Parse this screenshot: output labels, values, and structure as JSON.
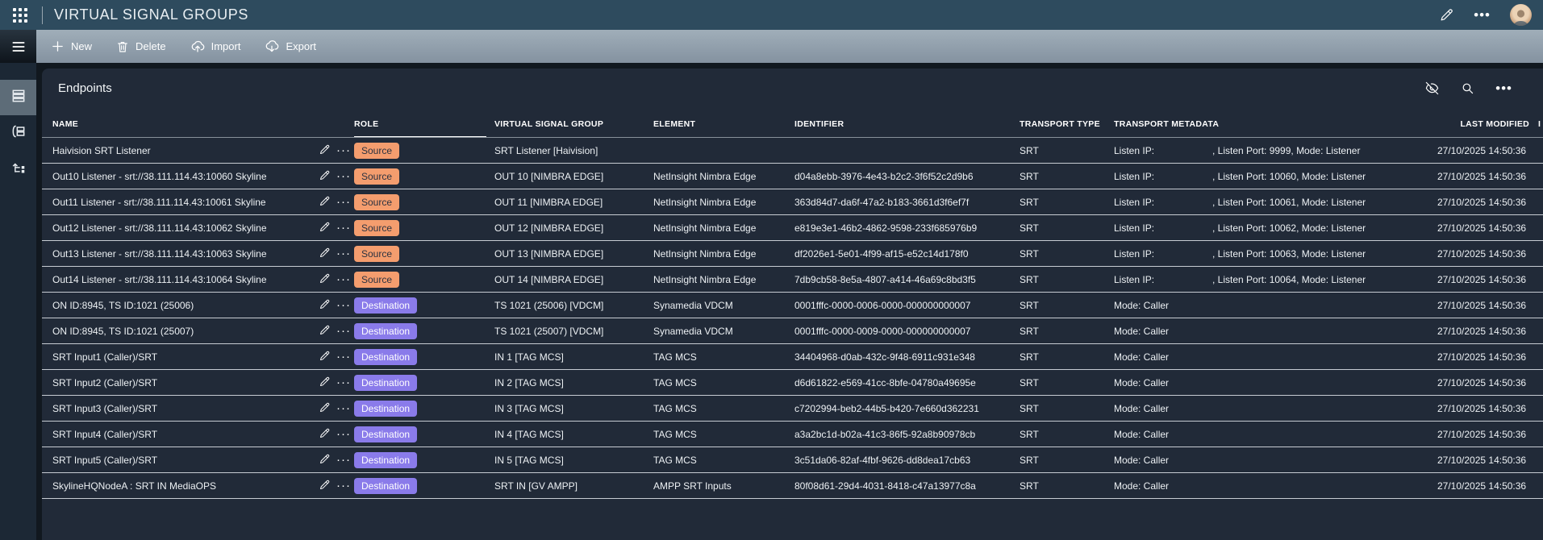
{
  "app": {
    "title": "VIRTUAL SIGNAL GROUPS"
  },
  "toolbar": {
    "items": [
      {
        "label": "New",
        "icon": "plus-icon"
      },
      {
        "label": "Delete",
        "icon": "trash-icon"
      },
      {
        "label": "Import",
        "icon": "cloud-import-icon"
      },
      {
        "label": "Export",
        "icon": "cloud-export-icon"
      }
    ]
  },
  "sidebar": {
    "items": [
      {
        "icon": "list-rows-icon",
        "selected": true
      },
      {
        "icon": "grouped-rows-icon",
        "selected": false
      },
      {
        "icon": "hierarchy-flow-icon",
        "selected": false
      }
    ]
  },
  "panel": {
    "title": "Endpoints",
    "actions": [
      "eye-off-icon",
      "search-icon",
      "ellipsis-icon"
    ]
  },
  "table": {
    "columns": [
      "NAME",
      "ROLE",
      "VIRTUAL SIGNAL GROUP",
      "ELEMENT",
      "IDENTIFIER",
      "TRANSPORT TYPE",
      "TRANSPORT METADATA",
      "LAST MODIFIED",
      "I"
    ],
    "sorted_column": "ROLE",
    "rows": [
      {
        "name": "Haivision SRT Listener",
        "role": "Source",
        "vsg": "SRT Listener [Haivision]",
        "element": "",
        "identifier": "",
        "transport_type": "SRT",
        "meta_label": "Listen IP:",
        "meta_rest": ", Listen Port: 9999, Mode: Listener",
        "last_modified": "27/10/2025 14:50:36"
      },
      {
        "name": "Out10 Listener - srt://38.111.114.43:10060 Skyline",
        "role": "Source",
        "vsg": "OUT 10 [NIMBRA EDGE]",
        "element": "NetInsight Nimbra Edge",
        "identifier": "d04a8ebb-3976-4e43-b2c2-3f6f52c2d9b6",
        "transport_type": "SRT",
        "meta_label": "Listen IP:",
        "meta_rest": ", Listen Port: 10060, Mode: Listener",
        "last_modified": "27/10/2025 14:50:36"
      },
      {
        "name": "Out11 Listener - srt://38.111.114.43:10061 Skyline",
        "role": "Source",
        "vsg": "OUT 11 [NIMBRA EDGE]",
        "element": "NetInsight Nimbra Edge",
        "identifier": "363d84d7-da6f-47a2-b183-3661d3f6ef7f",
        "transport_type": "SRT",
        "meta_label": "Listen IP:",
        "meta_rest": ", Listen Port: 10061, Mode: Listener",
        "last_modified": "27/10/2025 14:50:36"
      },
      {
        "name": "Out12 Listener - srt://38.111.114.43:10062 Skyline",
        "role": "Source",
        "vsg": "OUT 12 [NIMBRA EDGE]",
        "element": "NetInsight Nimbra Edge",
        "identifier": "e819e3e1-46b2-4862-9598-233f685976b9",
        "transport_type": "SRT",
        "meta_label": "Listen IP:",
        "meta_rest": ", Listen Port: 10062, Mode: Listener",
        "last_modified": "27/10/2025 14:50:36"
      },
      {
        "name": "Out13 Listener - srt://38.111.114.43:10063 Skyline",
        "role": "Source",
        "vsg": "OUT 13 [NIMBRA EDGE]",
        "element": "NetInsight Nimbra Edge",
        "identifier": "df2026e1-5e01-4f99-af15-e52c14d178f0",
        "transport_type": "SRT",
        "meta_label": "Listen IP:",
        "meta_rest": ", Listen Port: 10063, Mode: Listener",
        "last_modified": "27/10/2025 14:50:36"
      },
      {
        "name": "Out14 Listener - srt://38.111.114.43:10064 Skyline",
        "role": "Source",
        "vsg": "OUT 14 [NIMBRA EDGE]",
        "element": "NetInsight Nimbra Edge",
        "identifier": "7db9cb58-8e5a-4807-a414-46a69c8bd3f5",
        "transport_type": "SRT",
        "meta_label": "Listen IP:",
        "meta_rest": ", Listen Port: 10064, Mode: Listener",
        "last_modified": "27/10/2025 14:50:36"
      },
      {
        "name": "ON ID:8945, TS ID:1021 (25006)",
        "role": "Destination",
        "vsg": "TS 1021 (25006) [VDCM]",
        "element": "Synamedia VDCM",
        "identifier": "0001fffc-0000-0006-0000-000000000007",
        "transport_type": "SRT",
        "meta_label": "Mode: Caller",
        "meta_rest": "",
        "last_modified": "27/10/2025 14:50:36"
      },
      {
        "name": "ON ID:8945, TS ID:1021 (25007)",
        "role": "Destination",
        "vsg": "TS 1021 (25007) [VDCM]",
        "element": "Synamedia VDCM",
        "identifier": "0001fffc-0000-0009-0000-000000000007",
        "transport_type": "SRT",
        "meta_label": "Mode: Caller",
        "meta_rest": "",
        "last_modified": "27/10/2025 14:50:36"
      },
      {
        "name": "SRT Input1 (Caller)/SRT",
        "role": "Destination",
        "vsg": "IN 1 [TAG MCS]",
        "element": "TAG MCS",
        "identifier": "34404968-d0ab-432c-9f48-6911c931e348",
        "transport_type": "SRT",
        "meta_label": "Mode: Caller",
        "meta_rest": "",
        "last_modified": "27/10/2025 14:50:36"
      },
      {
        "name": "SRT Input2 (Caller)/SRT",
        "role": "Destination",
        "vsg": "IN 2 [TAG MCS]",
        "element": "TAG MCS",
        "identifier": "d6d61822-e569-41cc-8bfe-04780a49695e",
        "transport_type": "SRT",
        "meta_label": "Mode: Caller",
        "meta_rest": "",
        "last_modified": "27/10/2025 14:50:36"
      },
      {
        "name": "SRT Input3 (Caller)/SRT",
        "role": "Destination",
        "vsg": "IN 3 [TAG MCS]",
        "element": "TAG MCS",
        "identifier": "c7202994-beb2-44b5-b420-7e660d362231",
        "transport_type": "SRT",
        "meta_label": "Mode: Caller",
        "meta_rest": "",
        "last_modified": "27/10/2025 14:50:36"
      },
      {
        "name": "SRT Input4 (Caller)/SRT",
        "role": "Destination",
        "vsg": "IN 4 [TAG MCS]",
        "element": "TAG MCS",
        "identifier": "a3a2bc1d-b02a-41c3-86f5-92a8b90978cb",
        "transport_type": "SRT",
        "meta_label": "Mode: Caller",
        "meta_rest": "",
        "last_modified": "27/10/2025 14:50:36"
      },
      {
        "name": "SRT Input5 (Caller)/SRT",
        "role": "Destination",
        "vsg": "IN 5 [TAG MCS]",
        "element": "TAG MCS",
        "identifier": "3c51da06-82af-4fbf-9626-dd8dea17cb63",
        "transport_type": "SRT",
        "meta_label": "Mode: Caller",
        "meta_rest": "",
        "last_modified": "27/10/2025 14:50:36"
      },
      {
        "name": "SkylineHQNodeA : SRT IN MediaOPS",
        "role": "Destination",
        "vsg": "SRT IN [GV AMPP]",
        "element": "AMPP SRT Inputs",
        "identifier": "80f08d61-29d4-4031-8418-c47a13977c8a",
        "transport_type": "SRT",
        "meta_label": "Mode: Caller",
        "meta_rest": "",
        "last_modified": "27/10/2025 14:50:36"
      }
    ]
  },
  "colors": {
    "topbar": "#2E4B5E",
    "toolbar_top": "#A0AEB9",
    "toolbar_bottom": "#8492A0",
    "sidebar": "#1C2835",
    "sidebar_selected": "#5D6C78",
    "page_bg": "#11181F",
    "panel_bg": "#212A38",
    "source_badge_bg": "#F49D6E",
    "source_badge_text": "#2B3240",
    "destination_badge_bg": "#8A7BEA",
    "destination_badge_text": "#FFFFFF"
  }
}
